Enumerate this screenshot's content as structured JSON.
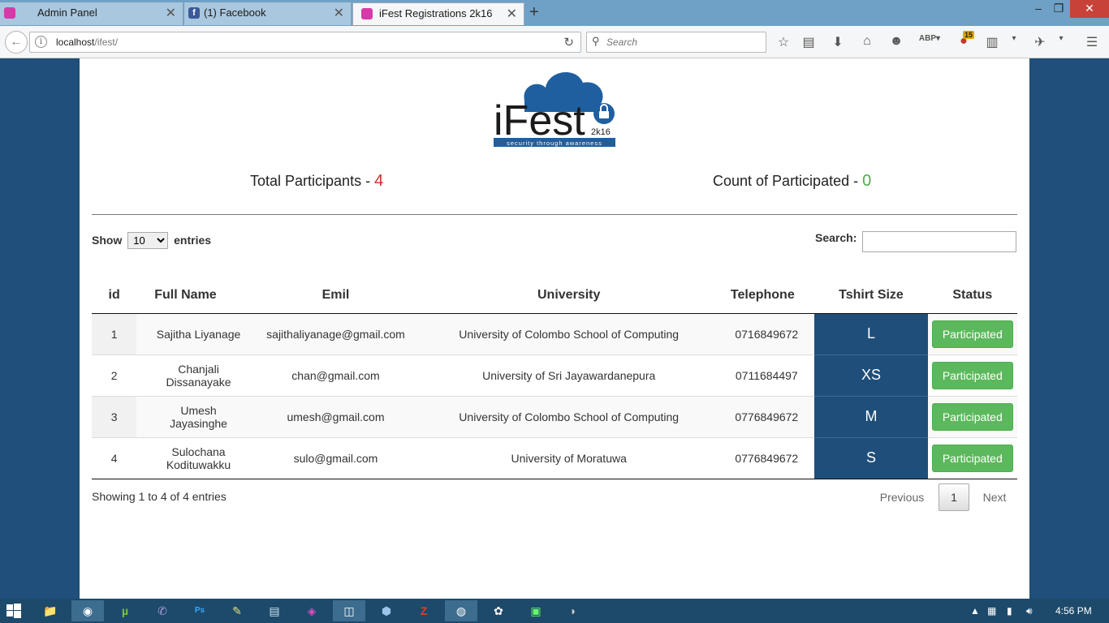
{
  "browser": {
    "tabs": [
      {
        "label": "Admin Panel",
        "icon": "ifest-tab-icon"
      },
      {
        "label": "(1) Facebook",
        "icon": "facebook-tab-icon"
      },
      {
        "label": "iFest Registrations 2k16",
        "icon": "ifest-tab-icon"
      }
    ],
    "url_host": "localhost",
    "url_path": "/ifest/",
    "search_placeholder": "Search",
    "notification_badge": "15"
  },
  "page": {
    "logo_text": "iFest",
    "logo_year": "2k16",
    "logo_tagline": "security through awareness",
    "total_label": "Total Participants - ",
    "total_value": "4",
    "participated_label": "Count of Participated - ",
    "participated_value": "0",
    "show_label": "Show",
    "entries_label": "entries",
    "entries_option": "10",
    "search_label": "Search:",
    "columns": [
      "id",
      "Full Name",
      "Emil",
      "University",
      "Telephone",
      "Tshirt Size",
      "Status"
    ],
    "rows": [
      {
        "id": "1",
        "name": "Sajitha Liyanage",
        "email": "sajithaliyanage@gmail.com",
        "university": "University of Colombo School of Computing",
        "phone": "0716849672",
        "size": "L",
        "status": "Participated"
      },
      {
        "id": "2",
        "name": "Chanjali Dissanayake",
        "email": "chan@gmail.com",
        "university": "University of Sri Jayawardanepura",
        "phone": "0711684497",
        "size": "XS",
        "status": "Participated"
      },
      {
        "id": "3",
        "name": "Umesh Jayasinghe",
        "email": "umesh@gmail.com",
        "university": "University of Colombo School of Computing",
        "phone": "0776849672",
        "size": "M",
        "status": "Participated"
      },
      {
        "id": "4",
        "name": "Sulochana Kodituwakku",
        "email": "sulo@gmail.com",
        "university": "University of Moratuwa",
        "phone": "0776849672",
        "size": "S",
        "status": "Participated"
      }
    ],
    "showing_text": "Showing 1 to 4 of 4 entries",
    "pagination": {
      "previous": "Previous",
      "current": "1",
      "next": "Next"
    }
  },
  "taskbar": {
    "clock": "4:56 PM"
  },
  "colors": {
    "accent_blue": "#1f4e7a",
    "success_green": "#5cb85c",
    "count_red": "#c9302c"
  }
}
